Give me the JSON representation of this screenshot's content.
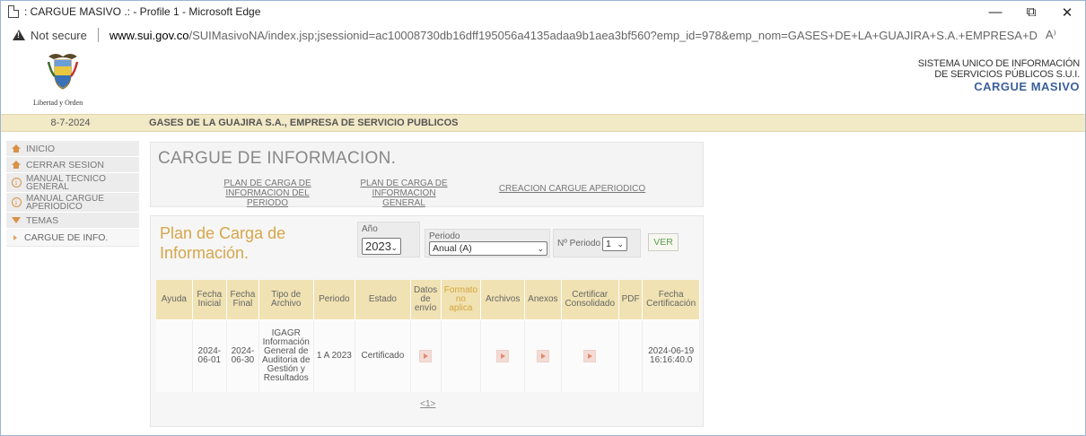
{
  "window": {
    "title": ": CARGUE MASIVO .: - Profile 1 - Microsoft Edge",
    "controls": {
      "minimize": "—",
      "restore": "⧉",
      "close": "✕"
    }
  },
  "address": {
    "security_label": "Not secure",
    "url_host": "www.sui.gov.co",
    "url_rest": "/SUIMasivoNA/index.jsp;jsessionid=ac10008730db16dff195056a4135adaa9b1aea3bf560?emp_id=978&emp_nom=GASES+DE+LA+GUAJIRA+S.A.+EMPRESA+DE...",
    "read_aloud": "A⁾"
  },
  "header": {
    "crest_caption": "Libertad y Orden",
    "system_line1": "SISTEMA UNICO DE INFORMACIÓN",
    "system_line2": "DE SERVICIOS PÚBLICOS S.U.I.",
    "system_line3": "CARGUE MASIVO"
  },
  "infobar": {
    "date": "8-7-2024",
    "company": "GASES DE LA GUAJIRA S.A., EMPRESA DE SERVICIO PUBLICOS"
  },
  "sidebar": {
    "items": [
      {
        "label": "INICIO",
        "icon": "home-icon"
      },
      {
        "label": "CERRAR SESION",
        "icon": "home-icon"
      },
      {
        "label": "MANUAL TECNICO GENERAL",
        "icon": "info-icon"
      },
      {
        "label": "MANUAL CARGUE APERIODICO",
        "icon": "info-icon"
      },
      {
        "label": "TEMAS",
        "icon": "triangle-down-icon"
      }
    ],
    "subitem": "CARGUE DE INFO."
  },
  "main": {
    "heading": "CARGUE DE INFORMACION.",
    "links": [
      "PLAN DE CARGA DE INFORMACION DEL PERIODO",
      "PLAN DE CARGA DE INFORMACION GENERAL",
      "CREACION CARGUE APERIODICO"
    ]
  },
  "plan": {
    "title": "Plan de Carga de Información.",
    "year_label": "Año",
    "year_value": "2023",
    "period_label": "Periodo",
    "period_value": "Anual (A)",
    "nperiod_label": "Nº Periodo",
    "nperiod_value": "1",
    "ver_label": "VER"
  },
  "table": {
    "headers": [
      "Ayuda",
      "Fecha Inicial",
      "Fecha Final",
      "Tipo de Archivo",
      "Periodo",
      "Estado",
      "Datos de envío",
      "Formato no aplica",
      "Archivos",
      "Anexos",
      "Certificar Consolidado",
      "PDF",
      "Fecha Certificación"
    ],
    "row": {
      "ayuda": "",
      "fecha_inicial": "2024-06-01",
      "fecha_final": "2024-06-30",
      "tipo": "IGAGR Información General de Auditoria de Gestión y Resultados",
      "periodo": "1 A 2023",
      "estado": "Certificado",
      "fecha_cert": "2024-06-19 16:16:40.0"
    },
    "pager": "<1>"
  },
  "colors": {
    "accent_orange": "#d99145",
    "title_gold": "#d6a64a",
    "header_row": "#f0e2b2",
    "infobar": "#f2e9c6",
    "brand_blue": "#3a5f9c"
  }
}
